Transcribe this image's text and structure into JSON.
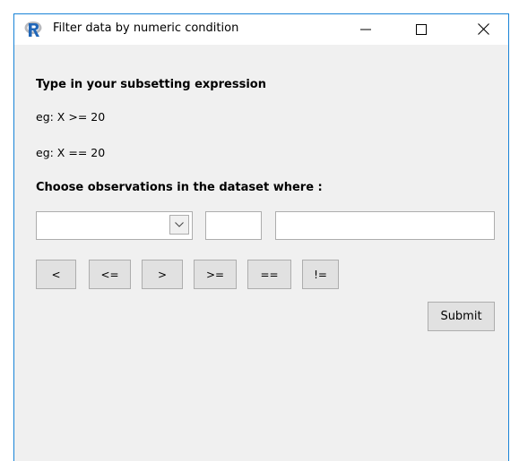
{
  "window": {
    "title": "Filter data by numeric condition",
    "accent_color": "#1883d7",
    "app_icon": "r-logo-icon"
  },
  "content": {
    "heading": "Type in your subsetting expression",
    "example1": "eg: X >= 20",
    "example2": "eg: X == 20",
    "choose_label": "Choose observations in the dataset where :"
  },
  "form": {
    "variable_select_value": "",
    "operator_value": "",
    "value_value": ""
  },
  "operators": [
    "<",
    "<=",
    ">",
    ">=",
    "==",
    "!="
  ],
  "submit_label": "Submit"
}
